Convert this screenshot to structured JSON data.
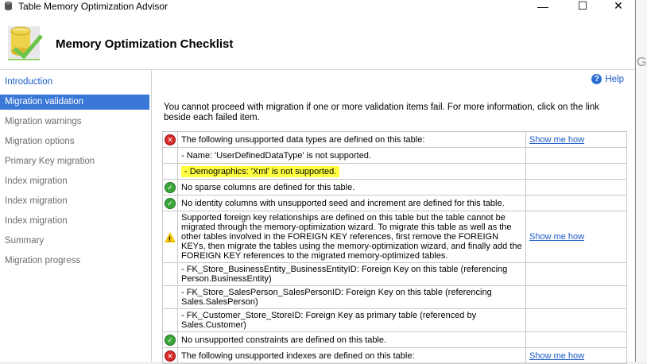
{
  "window": {
    "title": "Table Memory Optimization Advisor",
    "minimize_glyph": "—",
    "maximize_glyph": "☐",
    "close_glyph": "✕"
  },
  "header": {
    "heading": "Memory Optimization Checklist",
    "logo_icon": "database-check-icon"
  },
  "nav": {
    "items": [
      {
        "label": "Introduction",
        "state": "link"
      },
      {
        "label": "Migration validation",
        "state": "active"
      },
      {
        "label": "Migration warnings",
        "state": "disabled"
      },
      {
        "label": "Migration options",
        "state": "disabled"
      },
      {
        "label": "Primary Key migration",
        "state": "disabled"
      },
      {
        "label": "Index migration",
        "state": "disabled"
      },
      {
        "label": "Index migration",
        "state": "disabled"
      },
      {
        "label": "Index migration",
        "state": "disabled"
      },
      {
        "label": "Summary",
        "state": "disabled"
      },
      {
        "label": "Migration progress",
        "state": "disabled"
      }
    ]
  },
  "content": {
    "help_label": "Help",
    "intro": "You cannot proceed with migration if one or more validation items fail. For more information, click on the link beside each failed item.",
    "rows": [
      {
        "icon": "error",
        "text": "The following unsupported data types are defined on this table:",
        "link": "Show me how"
      },
      {
        "icon": "",
        "text": " - Name: 'UserDefinedDataType' is not supported.",
        "link": ""
      },
      {
        "icon": "",
        "text": " - Demographics: 'Xml' is not supported.",
        "link": "",
        "highlight": true
      },
      {
        "icon": "ok",
        "text": "No sparse columns are defined for this table.",
        "link": ""
      },
      {
        "icon": "ok",
        "text": "No identity columns with unsupported seed and increment are defined for this table.",
        "link": ""
      },
      {
        "icon": "warning",
        "text": "Supported foreign key relationships are defined on this table but the table cannot be migrated through the memory-optimization wizard. To migrate this table as well as the other tables involved in the FOREIGN KEY references, first remove the FOREIGN KEYs, then migrate the tables using the memory-optimization wizard, and finally add the FOREIGN KEY references to the migrated memory-optimized tables.",
        "link": "Show me how"
      },
      {
        "icon": "",
        "text": " - FK_Store_BusinessEntity_BusinessEntityID: Foreign Key on this table (referencing Person.BusinessEntity)",
        "link": ""
      },
      {
        "icon": "",
        "text": " - FK_Store_SalesPerson_SalesPersonID: Foreign Key on this table (referencing Sales.SalesPerson)",
        "link": ""
      },
      {
        "icon": "",
        "text": " - FK_Customer_Store_StoreID: Foreign Key as primary table (referenced by Sales.Customer)",
        "link": ""
      },
      {
        "icon": "ok",
        "text": "No unsupported constraints are defined on this table.",
        "link": ""
      },
      {
        "icon": "error",
        "text": "The following unsupported indexes are defined on this table:",
        "link": "Show me how"
      }
    ]
  },
  "background_window": {
    "fragment": "G"
  },
  "colors": {
    "accent": "#3a78d8",
    "link": "#1a5ac8",
    "error": "#d62a2a",
    "ok": "#3aa63a",
    "warning": "#f2c200",
    "highlight": "#ffff40"
  }
}
